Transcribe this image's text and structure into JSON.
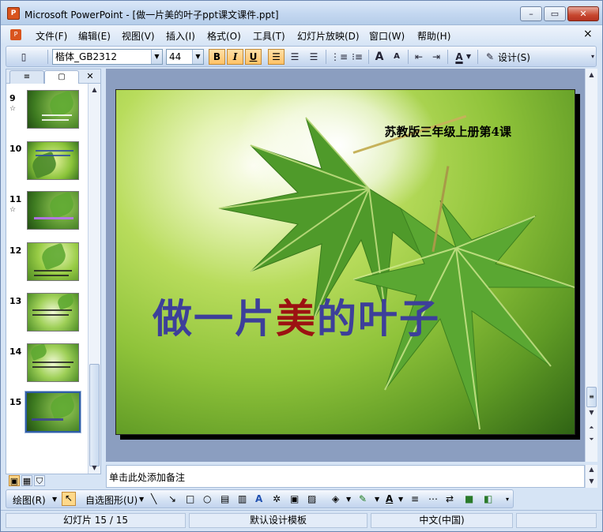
{
  "window": {
    "title": "Microsoft PowerPoint - [做一片美的叶子ppt课文课件.ppt]",
    "app_icon_text": "P",
    "min": "–",
    "max": "▭",
    "close": "✕"
  },
  "menu": {
    "items": [
      "文件(F)",
      "编辑(E)",
      "视图(V)",
      "插入(I)",
      "格式(O)",
      "工具(T)",
      "幻灯片放映(D)",
      "窗口(W)",
      "帮助(H)"
    ],
    "close": "×"
  },
  "toolbar": {
    "font_name": "楷体_GB2312",
    "font_size": "44",
    "bold": "B",
    "italic": "I",
    "underline": "U",
    "design_label": "设计(S)",
    "font_color_label": "A",
    "grow": "A",
    "shrink": "A"
  },
  "slides_pane": {
    "tab_outline": "≡",
    "tab_slides": "▢",
    "close": "✕",
    "slides": [
      {
        "num": "9",
        "star": "☆"
      },
      {
        "num": "10",
        "star": ""
      },
      {
        "num": "11",
        "star": "☆"
      },
      {
        "num": "12",
        "star": ""
      },
      {
        "num": "13",
        "star": ""
      },
      {
        "num": "14",
        "star": ""
      },
      {
        "num": "15",
        "star": ""
      }
    ]
  },
  "slide": {
    "subtitle": "苏教版三年级上册第4课",
    "title_part1": "做一片",
    "title_mei": "美",
    "title_part2": "的叶子",
    "colors": {
      "title": "#3d3f9a",
      "mei": "#9c1212"
    }
  },
  "notes": {
    "placeholder": "单击此处添加备注"
  },
  "drawing": {
    "draw_label": "绘图(R)",
    "autoshapes_label": "自选图形(U)"
  },
  "status": {
    "slide_counter": "幻灯片 15 / 15",
    "template": "默认设计模板",
    "language": "中文(中国)"
  }
}
